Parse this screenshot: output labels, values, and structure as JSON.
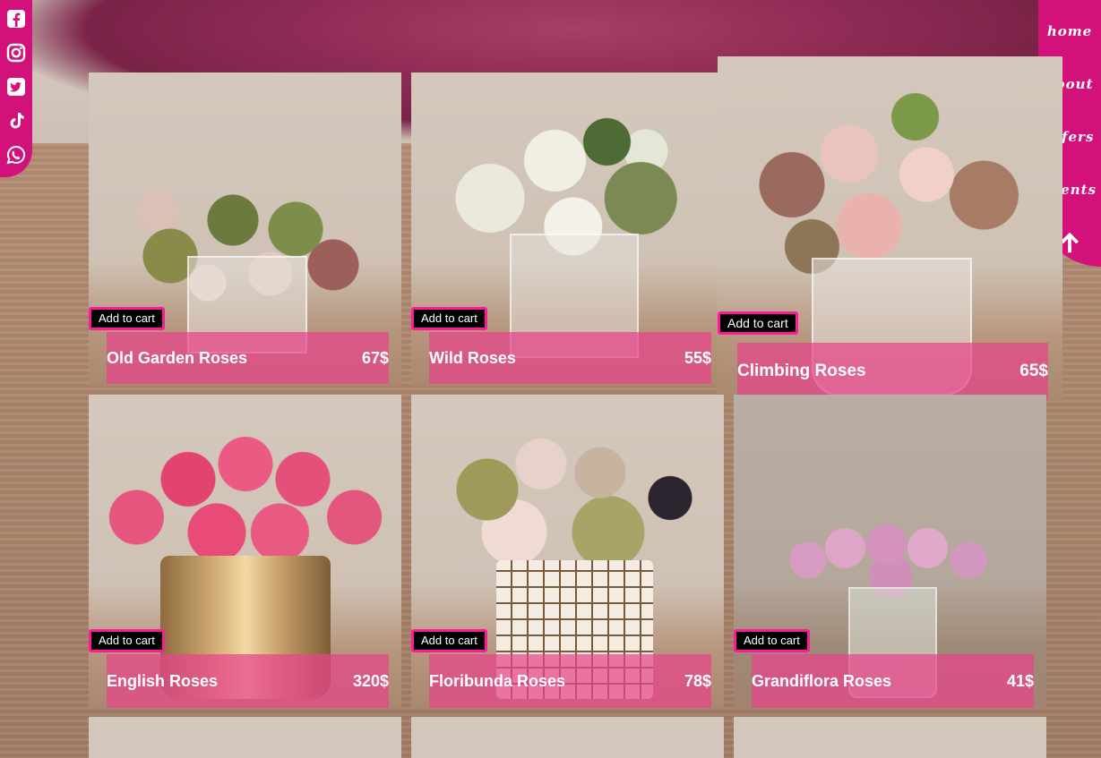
{
  "social": {
    "icons": [
      "facebook-icon",
      "instagram-icon",
      "twitter-icon",
      "tiktok-icon",
      "whatsapp-icon"
    ],
    "color": "#d2127a"
  },
  "nav": {
    "items": [
      {
        "label": "home"
      },
      {
        "label": "about"
      },
      {
        "label": "offers"
      },
      {
        "label": "events"
      }
    ],
    "scroll_top_icon": "arrow-up-icon",
    "color": "#d2127a"
  },
  "cart_button_label": "Add to cart",
  "products": [
    {
      "name": "Old Garden Roses",
      "price": "67$"
    },
    {
      "name": "Wild Roses",
      "price": "55$"
    },
    {
      "name": "Climbing Roses",
      "price": "65$"
    },
    {
      "name": "English Roses",
      "price": "320$"
    },
    {
      "name": "Floribunda Roses",
      "price": "78$"
    },
    {
      "name": "Grandiflora Roses",
      "price": "41$"
    }
  ],
  "colors": {
    "accent": "#d2127a",
    "price_bar": "#e7448c",
    "cart_border": "#ff1a9a"
  }
}
